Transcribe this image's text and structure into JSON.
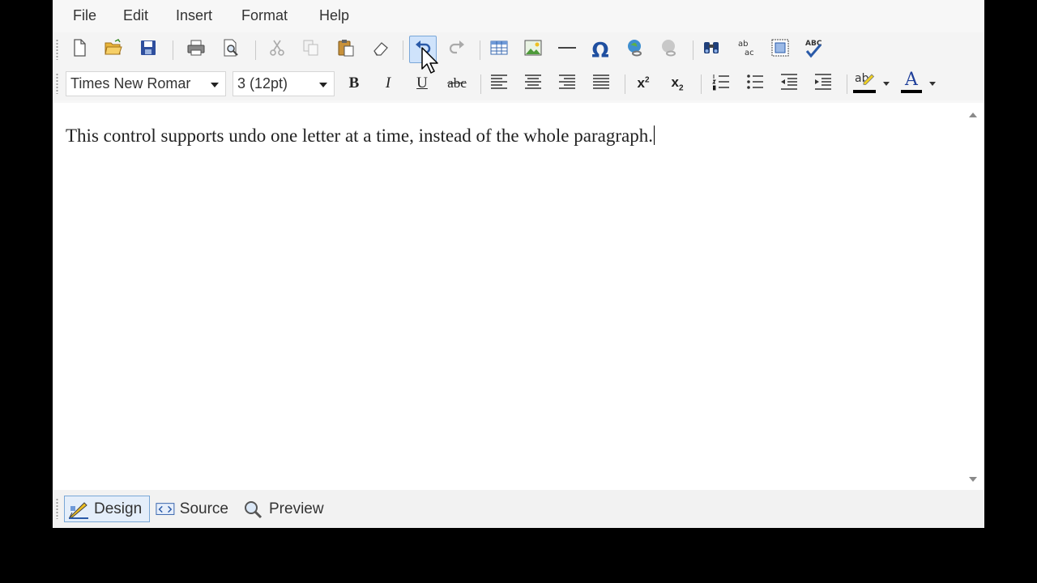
{
  "menu": [
    "File",
    "Edit",
    "Insert",
    "Format",
    "Help"
  ],
  "toolbar1": {
    "icons": [
      "new-document-icon",
      "open-folder-icon",
      "save-icon",
      "print-icon",
      "print-preview-icon",
      "cut-icon",
      "copy-icon",
      "paste-icon",
      "eraser-icon",
      "undo-icon",
      "redo-icon",
      "table-icon",
      "image-icon",
      "horizontal-line-icon",
      "omega-symbol-icon",
      "hyperlink-icon",
      "unlink-icon",
      "find-icon",
      "replace-icon",
      "select-all-icon",
      "spellcheck-icon"
    ],
    "omega": "Ω",
    "replace_top": "ab",
    "replace_bottom": "ac",
    "spell": "ABC"
  },
  "format": {
    "font_name": "Times New Romar",
    "font_size": "3 (12pt)",
    "bold": "B",
    "italic": "I",
    "underline": "U",
    "strike": "abc",
    "superscript": "x",
    "sup_mark": "2",
    "subscript": "x",
    "sub_mark": "2",
    "highlight": "ab",
    "font_color": "A",
    "highlight_color": "#000000",
    "font_color_bar": "#000000"
  },
  "editor": {
    "text": "This control supports undo one letter at a time, instead of the whole paragraph."
  },
  "tabs": {
    "design": "Design",
    "source": "Source",
    "preview": "Preview"
  },
  "colors": {
    "accent": "#cfe3fb",
    "accent_border": "#7aa7d8"
  }
}
